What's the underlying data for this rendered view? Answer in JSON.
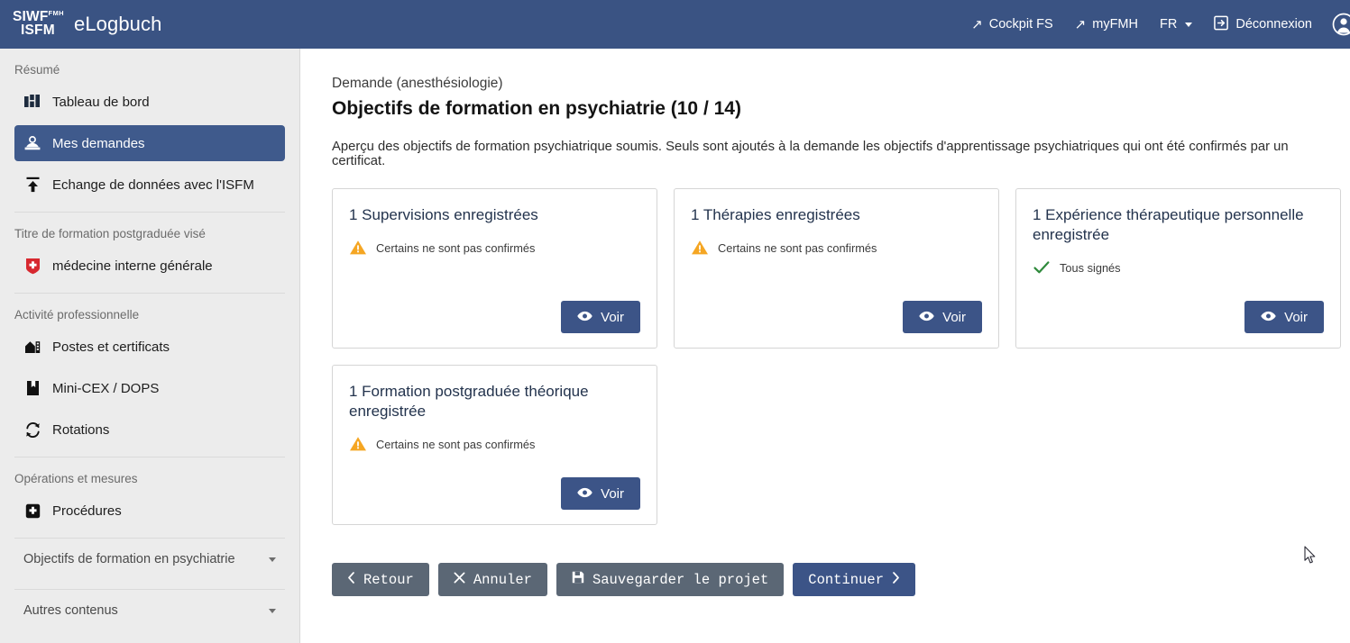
{
  "header": {
    "brand_line1": "SIWF",
    "brand_sup": "FMH",
    "brand_line2": "ISFM",
    "brand_title": "eLogbuch",
    "brand_color": "#3a5383",
    "nav": [
      {
        "label": "Cockpit FS",
        "icon": "external-link-icon"
      },
      {
        "label": "myFMH",
        "icon": "external-link-icon"
      },
      {
        "label": "FR",
        "icon": "chevron-down-icon"
      },
      {
        "label": "Déconnexion",
        "icon": "logout-icon"
      }
    ],
    "avatar_icon": "account-circle-icon"
  },
  "sidebar": {
    "background": "#ececec",
    "active_color": "#3f5a8c",
    "sections": [
      {
        "caption": "Résumé",
        "items": [
          {
            "label": "Tableau de bord",
            "icon": "dashboard-icon",
            "active": false
          },
          {
            "label": "Mes demandes",
            "icon": "inbox-person-icon",
            "active": true
          },
          {
            "label": "Echange de données avec l'ISFM",
            "icon": "upload-icon",
            "active": false
          }
        ]
      },
      {
        "caption": "Titre de formation postgraduée visé",
        "items": [
          {
            "label": "médecine interne générale",
            "icon": "swiss-cross-shield-icon",
            "active": false
          }
        ]
      },
      {
        "caption": "Activité professionnelle",
        "items": [
          {
            "label": "Postes et certificats",
            "icon": "hospital-icon",
            "active": false
          },
          {
            "label": "Mini-CEX / DOPS",
            "icon": "bookmark-icon",
            "active": false
          },
          {
            "label": "Rotations",
            "icon": "refresh-icon",
            "active": false
          }
        ]
      },
      {
        "caption": "Opérations et mesures",
        "items": [
          {
            "label": "Procédures",
            "icon": "medical-cross-box-icon",
            "active": false
          }
        ]
      }
    ],
    "collapsibles": [
      {
        "label": "Objectifs de formation en psychiatrie",
        "icon": "chevron-down-icon"
      },
      {
        "label": "Autres contenus",
        "icon": "chevron-down-icon"
      }
    ]
  },
  "main": {
    "breadcrumb": "Demande (anesthésiologie)",
    "page_title": "Objectifs de formation en psychiatrie (10 / 14)",
    "intro": "Aperçu des objectifs de formation psychiatrique soumis. Seuls sont ajoutés à la demande les objectifs d'apprentissage psychiatriques qui ont été confirmés par un certificat.",
    "cards": [
      {
        "title": "1 Supervisions enregistrées",
        "status_text": "Certains ne sont pas confirmés",
        "status_icon": "warning-triangle-icon",
        "status_color": "#f5a623",
        "button_label": "Voir",
        "button_icon": "eye-icon"
      },
      {
        "title": "1 Thérapies enregistrées",
        "status_text": "Certains ne sont pas confirmés",
        "status_icon": "warning-triangle-icon",
        "status_color": "#f5a623",
        "button_label": "Voir",
        "button_icon": "eye-icon"
      },
      {
        "title": "1 Expérience thérapeutique personnelle enregistrée",
        "status_text": "Tous signés",
        "status_icon": "check-icon",
        "status_color": "#2f8a3c",
        "button_label": "Voir",
        "button_icon": "eye-icon"
      },
      {
        "title": "1 Formation postgraduée théorique enregistrée",
        "status_text": "Certains ne sont pas confirmés",
        "status_icon": "warning-triangle-icon",
        "status_color": "#f5a623",
        "button_label": "Voir",
        "button_icon": "eye-icon"
      }
    ],
    "actions": [
      {
        "label": "Retour",
        "icon": "chevron-left-icon",
        "variant": "secondary"
      },
      {
        "label": "Annuler",
        "icon": "close-x-icon",
        "variant": "secondary"
      },
      {
        "label": "Sauvegarder le projet",
        "icon": "save-disk-icon",
        "variant": "secondary"
      },
      {
        "label": "Continuer",
        "icon": "chevron-right-icon",
        "variant": "primary"
      }
    ]
  }
}
